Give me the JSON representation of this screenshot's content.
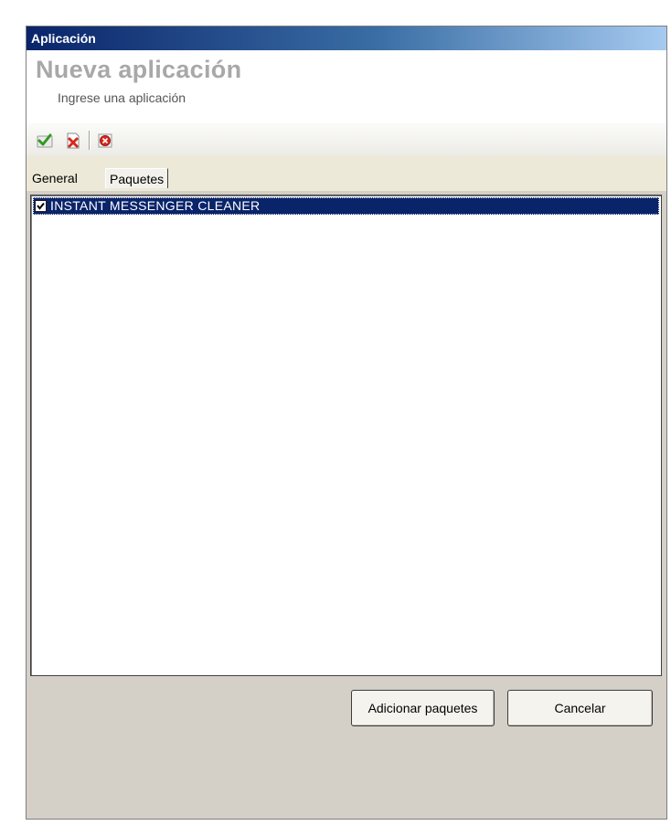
{
  "window": {
    "title": "Aplicación"
  },
  "header": {
    "title": "Nueva aplicación",
    "subtitle": "Ingrese una aplicación"
  },
  "toolbar": {
    "buttons": [
      {
        "icon": "checkmark-icon",
        "action": "accept"
      },
      {
        "icon": "delete-document-icon",
        "action": "remove"
      },
      {
        "icon": "cancel-icon",
        "action": "cancel"
      }
    ]
  },
  "tabs": [
    {
      "label": "General",
      "selected": false
    },
    {
      "label": "Paquetes",
      "selected": true
    }
  ],
  "packages": {
    "items": [
      {
        "label": "INSTANT MESSENGER CLEANER",
        "checked": true,
        "selected": true
      }
    ]
  },
  "footer": {
    "add_label": "Adicionar paquetes",
    "cancel_label": "Cancelar"
  },
  "colors": {
    "titlebar_start": "#0a246a",
    "titlebar_end": "#a6caf0",
    "selection": "#0a246a"
  }
}
